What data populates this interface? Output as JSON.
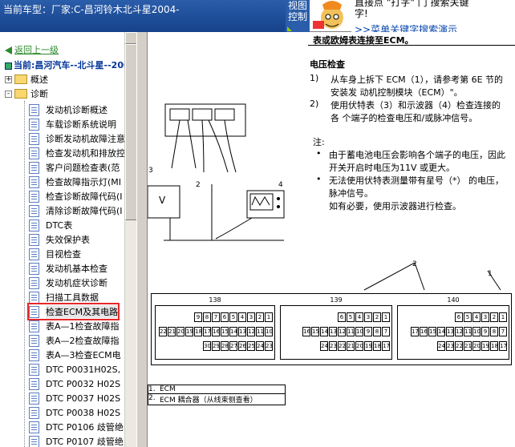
{
  "header": {
    "car_text": "当前车型：厂家:C-昌河铃木北斗星2004-",
    "view_label_1": "视图",
    "view_label_2": "控制",
    "tip_line1": "直接点 \"打字\" 门 搜索关键",
    "tip_line2": "字!",
    "tip_link": ">>菜单关键字搜索演示"
  },
  "tree": {
    "back_label": "返回上一级",
    "current_label": "当前:昌河汽车--北斗星--200",
    "folders": [
      {
        "label": "概述",
        "expander": "+"
      },
      {
        "label": "诊断",
        "expander": "-"
      }
    ],
    "items": [
      {
        "label": "发动机诊断概述"
      },
      {
        "label": "车载诊断系统说明"
      },
      {
        "label": "诊断发动机故障注意"
      },
      {
        "label": "检查发动机和排放控"
      },
      {
        "label": "客户问题检查表(范"
      },
      {
        "label": "检查故障指示灯(MI"
      },
      {
        "label": "检查诊断故障代码(I"
      },
      {
        "label": "清除诊断故障代码(I"
      },
      {
        "label": "DTC表"
      },
      {
        "label": "失效保护表"
      },
      {
        "label": "目视检查"
      },
      {
        "label": "发动机基本检查"
      },
      {
        "label": "发动机症状诊断"
      },
      {
        "label": "扫描工具数据"
      },
      {
        "label": "检查ECM及其电路"
      },
      {
        "label": "表A—1检查故障指"
      },
      {
        "label": "表A—2检查故障指"
      },
      {
        "label": "表A—3检查ECM电"
      },
      {
        "label": "DTC P0031H02S,"
      },
      {
        "label": "DTC P0032 H02S"
      },
      {
        "label": "DTC P0037 H02S"
      },
      {
        "label": "DTC P0038 H02S"
      },
      {
        "label": "DTC P0106 歧管绝"
      },
      {
        "label": "DTC P0107 歧管绝"
      }
    ]
  },
  "doc": {
    "intro": "表或欧姆表连接至ECM。",
    "section_title": "电压检查",
    "steps": [
      {
        "num": "1)",
        "line1": "从车身上拆下 ECM（1），请参考第 6E 节的",
        "line2": "安装发 动机控制模块（ECM）\"。"
      },
      {
        "num": "2)",
        "line1": "使用伏特表（3）和示波器（4）检查连接的",
        "line2": "各 个端子的检查电压和/或脉冲信号。"
      }
    ],
    "note_title": "注:",
    "notes": [
      {
        "line1": "由于蓄电池电压会影响各个端子的电压，因此",
        "line2": "开关开启时电压为11V 或更大。"
      },
      {
        "line1": "无法使用伏特表测量带有星号（*） 的电压，",
        "line2": "脉冲信号。"
      }
    ],
    "note_extra": "如有必要，使用示波器进行检查。",
    "fig_labels": {
      "a": "3",
      "b": "2",
      "c": "4",
      "d": "2",
      "e": "1"
    },
    "connectors": [
      {
        "name": "138",
        "rows": [
          [
            "9",
            "8",
            "7",
            "6",
            "5",
            "4",
            "3",
            "2",
            "1"
          ],
          [
            "22",
            "21",
            "20",
            "19",
            "18",
            "17",
            "16",
            "15",
            "14",
            "13",
            "12",
            "11",
            "10"
          ],
          [
            "30",
            "29",
            "28",
            "27",
            "26",
            "25",
            "24",
            "23"
          ]
        ]
      },
      {
        "name": "139",
        "rows": [
          [
            "6",
            "5",
            "4",
            "3",
            "2",
            "1"
          ],
          [
            "16",
            "15",
            "14",
            "13",
            "12",
            "11",
            "10",
            "9",
            "8",
            "7"
          ],
          [
            "24",
            "23",
            "22",
            "21",
            "20",
            "19",
            "18",
            "17"
          ]
        ]
      },
      {
        "name": "140",
        "rows": [
          [
            "6",
            "5",
            "4",
            "3",
            "2",
            "1"
          ],
          [
            "17",
            "16",
            "15",
            "14",
            "13",
            "12",
            "11",
            "10",
            "9",
            "8",
            "7"
          ],
          [
            "24",
            "23",
            "22",
            "21",
            "20",
            "19",
            "18",
            "17"
          ]
        ]
      }
    ],
    "legend": [
      {
        "num": "1.",
        "label": "ECM"
      },
      {
        "num": "2.",
        "label": "ECM 耦合器（从线束侧查看）"
      }
    ]
  }
}
